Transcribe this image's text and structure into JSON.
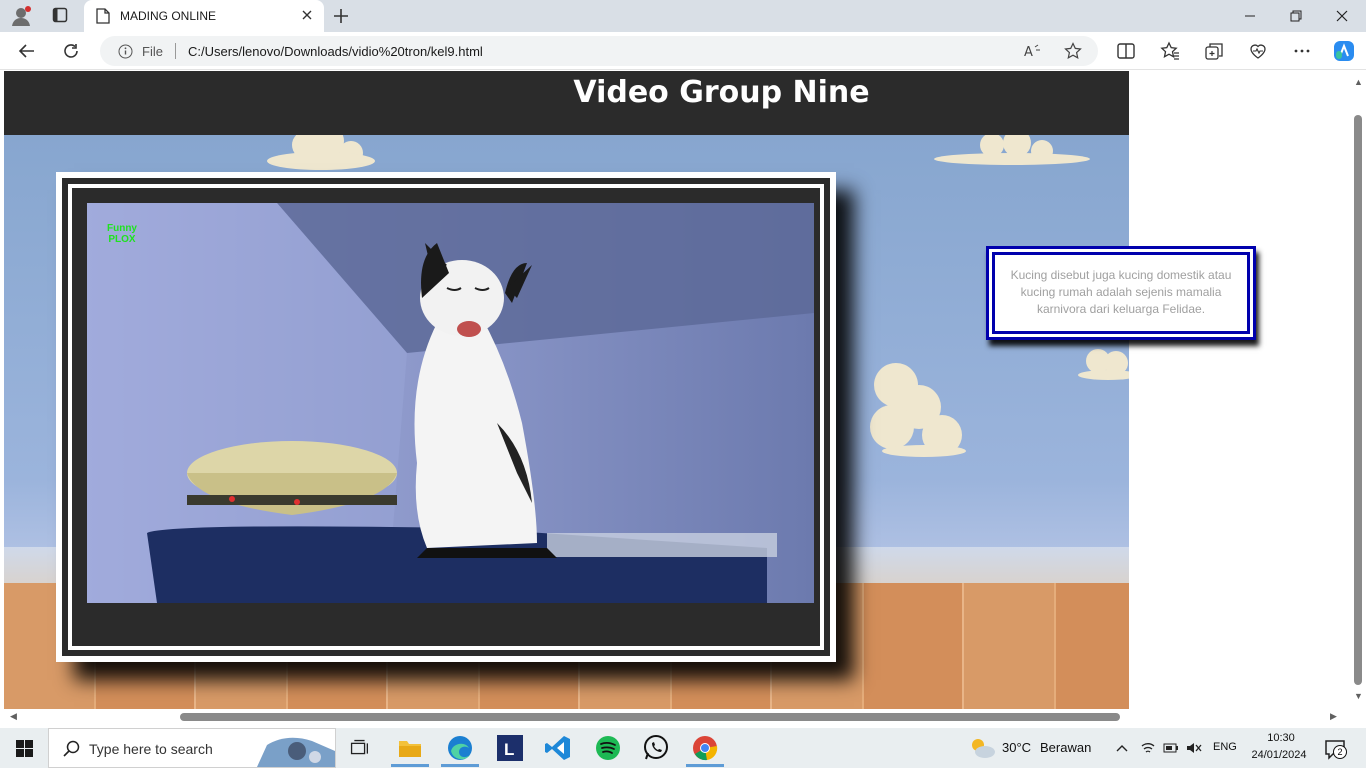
{
  "browser": {
    "tab_title": "MADING ONLINE",
    "file_label": "File",
    "url": "C:/Users/lenovo/Downloads/vidio%20tron/kel9.html"
  },
  "page": {
    "title": "Video Group Nine",
    "video_watermark_line1": "Funny",
    "video_watermark_line2": "PLOX",
    "info_text": "Kucing disebut juga kucing domestik atau kucing rumah adalah sejenis mamalia karnivora dari keluarga Felidae."
  },
  "taskbar": {
    "search_placeholder": "Type here to search",
    "weather_temp": "30°C",
    "weather_desc": "Berawan",
    "language": "ENG",
    "time": "10:30",
    "date": "24/01/2024",
    "notification_count": "2"
  },
  "icons": {
    "tab": "page-icon",
    "nav": [
      "back-arrow-icon",
      "reload-icon"
    ],
    "toolbar": [
      "split-screen-icon",
      "favorites-icon",
      "collections-icon",
      "browser-essentials-icon",
      "more-icon",
      "copilot-icon"
    ]
  },
  "colors": {
    "header_bg": "#2b2b2b",
    "info_border": "#0000ad",
    "watermark": "#1fe31f",
    "active_indicator": "#5e9cd6"
  }
}
